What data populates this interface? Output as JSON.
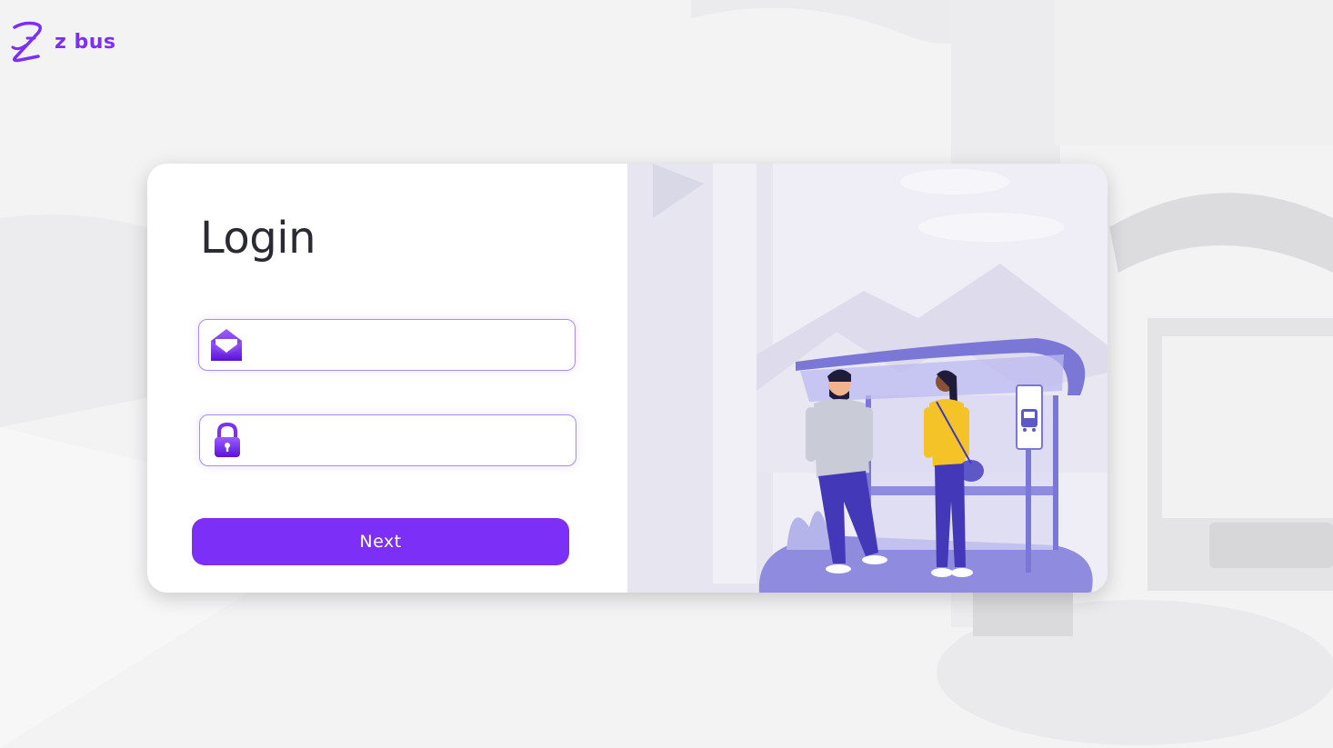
{
  "brand": {
    "name": "z bus",
    "icon": "z-logo-icon",
    "color": "#7b2ff7"
  },
  "login": {
    "title": "Login",
    "email": {
      "icon": "envelope-icon",
      "value": "",
      "placeholder": ""
    },
    "password": {
      "icon": "lock-icon",
      "value": "",
      "placeholder": ""
    },
    "next_label": "Next"
  },
  "illustration": {
    "sign_icon": "bus-sign-icon"
  }
}
